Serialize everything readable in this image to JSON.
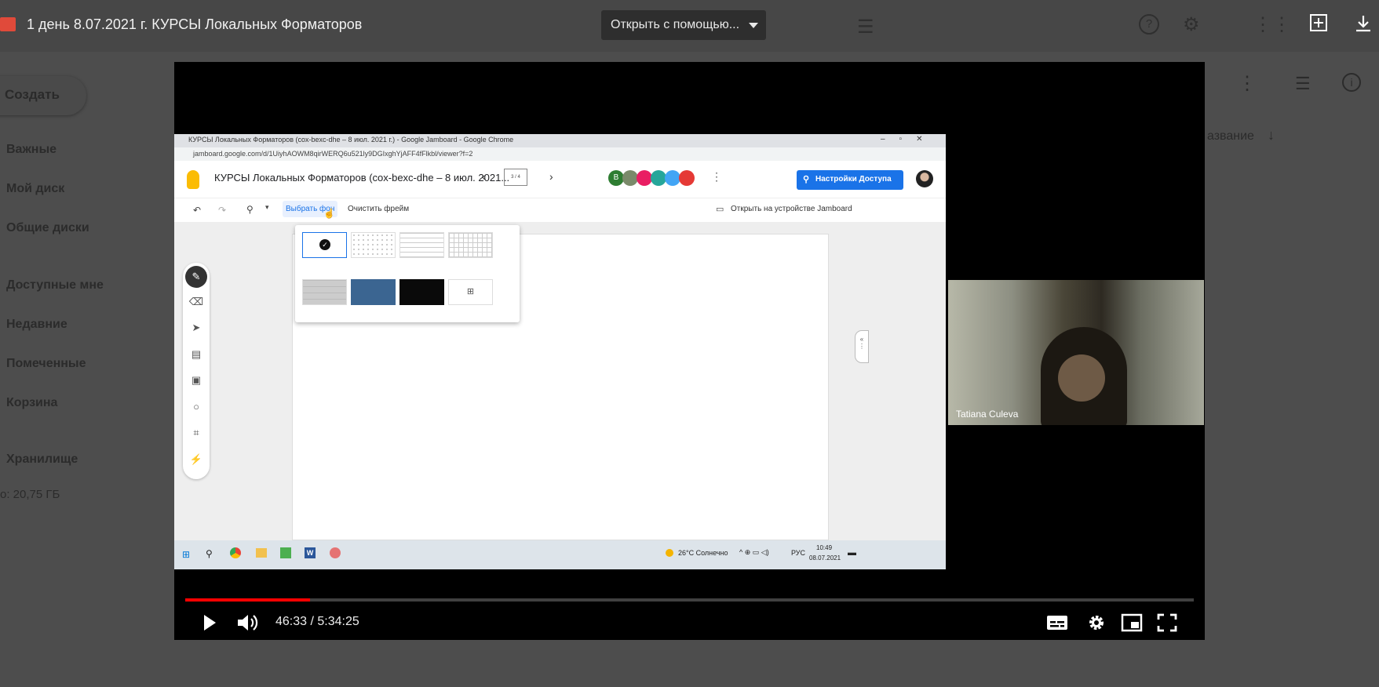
{
  "drive": {
    "create_label": "Создать",
    "sidebar": [
      "Важные",
      "Мой диск",
      "Общие диски",
      "Доступные мне",
      "Недавние",
      "Помеченные",
      "Корзина",
      "Хранилище"
    ],
    "storage_text": "о: 20,75 ГБ",
    "sort_label": "азвание"
  },
  "viewer": {
    "title": "1 день 8.07.2021 г. КУРСЫ Локальных Форматоров",
    "open_with": "Открыть с помощью..."
  },
  "screen": {
    "browser_title": "КУРСЫ Локальных Форматоров (cox-bexc-dhe – 8 июл. 2021 г.) - Google Jamboard - Google Chrome",
    "url": "jamboard.google.com/d/1UiyhAOWM8qirWERQ6u521ly9DGIxghYjAFF4fFlkbl/viewer?f=2",
    "jam_title": "КУРСЫ Локальных Форматоров (cox-bexc-dhe – 8 июл. 2021...",
    "frame_counter": "3 / 4",
    "share_button": "Настройки Доступа",
    "choose_bg": "Выбрать фон",
    "clear_frame": "Очистить фрейм",
    "open_on_device": "Открыть на устройстве Jamboard",
    "avatar_letter": "В",
    "taskbar": {
      "weather": "26°C Солнечно",
      "lang": "РУС",
      "clock": "10:49",
      "date": "08.07.2021"
    }
  },
  "pip": {
    "name": "Tatiana Culeva"
  },
  "player": {
    "time": "46:33 / 5:34:25",
    "progress": 0.124
  },
  "colors": {
    "progress": "#ff0000",
    "share": "#1a73e8",
    "swatch_blue": "#3b6591"
  }
}
